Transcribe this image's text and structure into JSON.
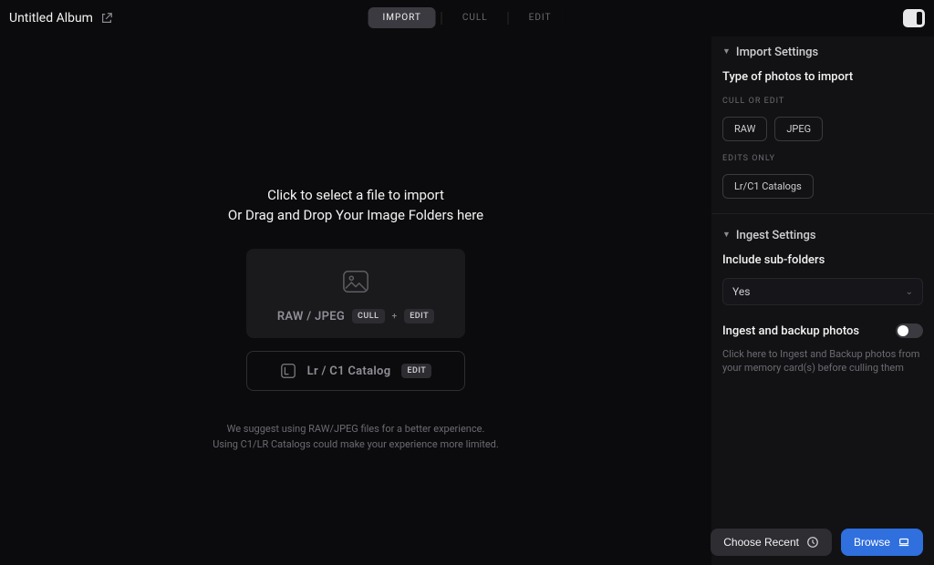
{
  "header": {
    "album_title": "Untitled Album",
    "tabs": {
      "import": "IMPORT",
      "cull": "CULL",
      "edit": "EDIT"
    }
  },
  "workspace": {
    "heading_line1": "Click to select a file to import",
    "heading_line2": "Or Drag and Drop Your Image Folders here",
    "raw_card": {
      "label": "RAW / JPEG",
      "chip1": "CULL",
      "chip2": "EDIT"
    },
    "catalog_card": {
      "label": "Lr / C1 Catalog",
      "chip": "EDIT"
    },
    "hint_line1": "We suggest using RAW/JPEG files for a better experience.",
    "hint_line2": "Using C1/LR Catalogs could make your experience more limited."
  },
  "side": {
    "import_settings": {
      "title": "Import Settings",
      "type_label": "Type of photos to import",
      "cull_or_edit_label": "CULL OR EDIT",
      "btn_raw": "RAW",
      "btn_jpeg": "JPEG",
      "edits_only_label": "EDITS ONLY",
      "btn_catalogs": "Lr/C1 Catalogs"
    },
    "ingest_settings": {
      "title": "Ingest Settings",
      "include_label": "Include sub-folders",
      "include_value": "Yes",
      "toggle_label": "Ingest and backup photos",
      "toggle_on": false,
      "toggle_desc": "Click here to Ingest and Backup photos from your memory card(s) before culling them"
    },
    "actions": {
      "choose_recent": "Choose Recent",
      "browse": "Browse"
    }
  }
}
